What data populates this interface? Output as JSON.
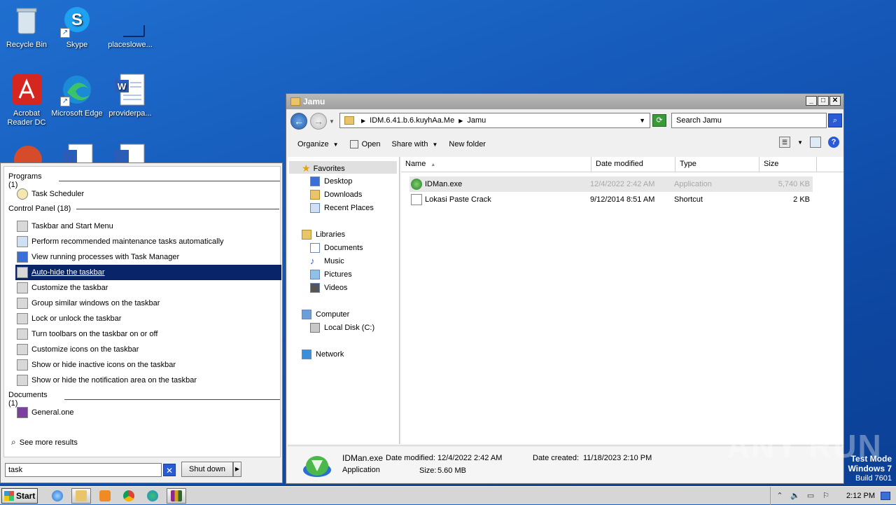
{
  "desktop": {
    "icons": [
      {
        "label": "Recycle Bin",
        "icon": "recycle-bin-icon"
      },
      {
        "label": "Skype",
        "icon": "skype-icon"
      },
      {
        "label": "placeslowe...",
        "icon": "blank-file-icon"
      },
      {
        "label": "Acrobat Reader DC",
        "icon": "acrobat-icon"
      },
      {
        "label": "Microsoft Edge",
        "icon": "edge-icon"
      },
      {
        "label": "providerpa...",
        "icon": "word-doc-icon"
      }
    ]
  },
  "start_menu": {
    "categories": [
      {
        "label": "Programs (1)"
      },
      {
        "label": "Control Panel (18)"
      },
      {
        "label": "Documents (1)"
      }
    ],
    "programs": [
      "Task Scheduler"
    ],
    "control_panel": [
      "Taskbar and Start Menu",
      "Perform recommended maintenance tasks automatically",
      "View running processes with Task Manager",
      "Auto-hide the taskbar",
      "Customize the taskbar",
      "Group similar windows on the taskbar",
      "Lock or unlock the taskbar",
      "Turn toolbars on the taskbar on or off",
      "Customize icons on the taskbar",
      "Show or hide inactive icons on the taskbar",
      "Show or hide the notification area on the taskbar"
    ],
    "selected_item": "Auto-hide the taskbar",
    "documents": [
      "General.one"
    ],
    "see_more": "See more results",
    "search_value": "task",
    "shutdown_label": "Shut down"
  },
  "explorer": {
    "title": "Jamu",
    "breadcrumb": [
      "IDM.6.41.b.6.kuyhAa.Me",
      "Jamu"
    ],
    "search_placeholder": "Search Jamu",
    "toolbar": {
      "organize": "Organize",
      "open": "Open",
      "share_with": "Share with",
      "new_folder": "New folder"
    },
    "nav": {
      "favorites": "Favorites",
      "favorites_items": [
        "Desktop",
        "Downloads",
        "Recent Places"
      ],
      "libraries": "Libraries",
      "libraries_items": [
        "Documents",
        "Music",
        "Pictures",
        "Videos"
      ],
      "computer": "Computer",
      "computer_items": [
        "Local Disk (C:)"
      ],
      "network": "Network"
    },
    "columns": [
      "Name",
      "Date modified",
      "Type",
      "Size"
    ],
    "files": [
      {
        "name": "IDMan.exe",
        "date": "12/4/2022 2:42 AM",
        "type": "Application",
        "size": "5,740 KB"
      },
      {
        "name": "Lokasi Paste Crack",
        "date": "9/12/2014 8:51 AM",
        "type": "Shortcut",
        "size": "2 KB"
      }
    ],
    "details": {
      "name": "IDMan.exe",
      "kind": "Application",
      "modified_label": "Date modified:",
      "modified_value": "12/4/2022 2:42 AM",
      "created_label": "Date created:",
      "created_value": "11/18/2023 2:10 PM",
      "size_label": "Size:",
      "size_value": "5.60 MB"
    }
  },
  "watermark": {
    "brand": "ANY RUN",
    "line1": "Test Mode",
    "line2": "Windows 7",
    "line3": "Build 7601"
  },
  "taskbar": {
    "start_label": "Start",
    "time": "2:12 PM"
  }
}
